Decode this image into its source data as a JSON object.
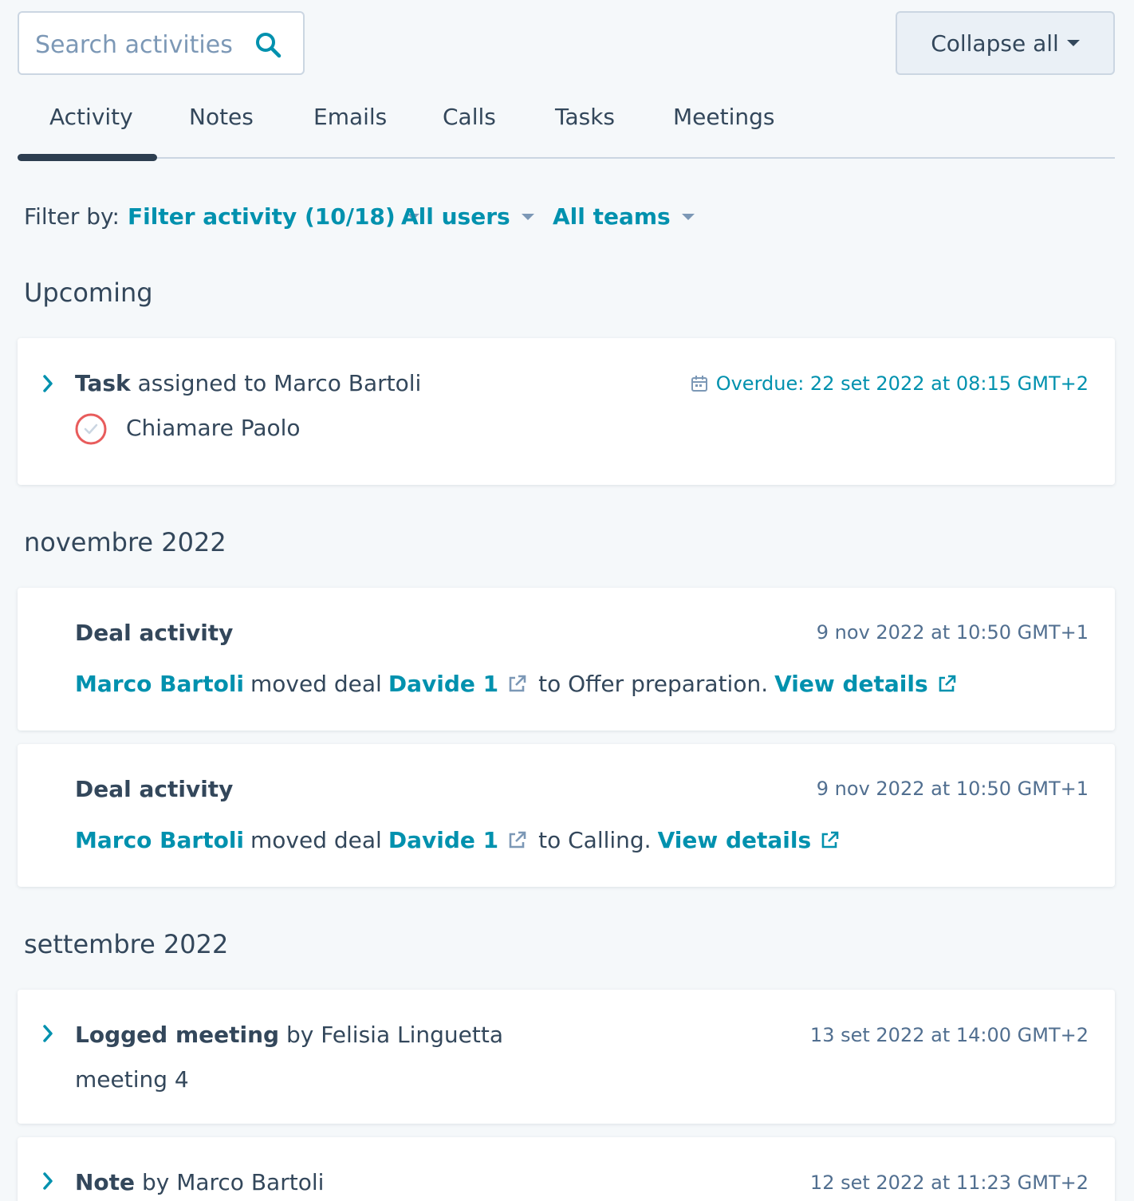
{
  "search": {
    "placeholder": "Search activities"
  },
  "collapse_label": "Collapse all",
  "tabs": [
    "Activity",
    "Notes",
    "Emails",
    "Calls",
    "Tasks",
    "Meetings"
  ],
  "filters": {
    "label": "Filter by:",
    "activity": "Filter activity (10/18)",
    "users": "All users",
    "teams": "All teams"
  },
  "sections": {
    "upcoming": "Upcoming",
    "nov": "novembre 2022",
    "sep": "settembre 2022"
  },
  "task": {
    "type": "Task",
    "assigned_text": "assigned to Marco Bartoli",
    "overdue": "Overdue: 22 set 2022 at 08:15 GMT+2",
    "name": "Chiamare Paolo"
  },
  "deals": [
    {
      "title": "Deal activity",
      "timestamp": "9 nov 2022 at 10:50 GMT+1",
      "user": "Marco Bartoli",
      "moved_text": "moved deal",
      "deal": "Davide 1",
      "to_text": "to Offer preparation.",
      "details": "View details"
    },
    {
      "title": "Deal activity",
      "timestamp": "9 nov 2022 at 10:50 GMT+1",
      "user": "Marco Bartoli",
      "moved_text": "moved deal",
      "deal": "Davide 1",
      "to_text": "to Calling.",
      "details": "View details"
    }
  ],
  "meeting": {
    "type": "Logged meeting",
    "by_text": "by Felisia Linguetta",
    "timestamp": "13 set 2022 at 14:00 GMT+2",
    "name": "meeting 4"
  },
  "note": {
    "type": "Note",
    "by_text": "by Marco Bartoli",
    "timestamp": "12 set 2022 at 11:23 GMT+2"
  },
  "colors": {
    "accent": "#0091ae",
    "text": "#33475b",
    "muted": "#516f90",
    "overdue_ring": "#e85c5c",
    "background": "#f5f8fa"
  },
  "icons": [
    "search-icon",
    "caret-down-icon",
    "chevron-right-icon",
    "calendar-icon",
    "task-complete-icon",
    "external-link-icon"
  ]
}
